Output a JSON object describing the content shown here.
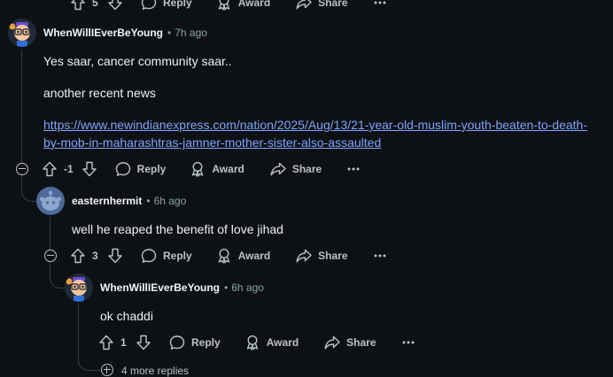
{
  "colors": {
    "background": "#0e1113",
    "text": "#eef1f3",
    "muted": "#8ba2ad",
    "link": "#7ea4ff",
    "thread_line": "#333d42"
  },
  "top_bar": {
    "score": "5",
    "reply": "Reply",
    "award": "Award",
    "share": "Share",
    "more": "···"
  },
  "comment1": {
    "author": "WhenWillIEverBeYoung",
    "separator": "•",
    "time": "7h ago",
    "para1": "Yes saar, cancer community saar..",
    "para2": "another recent news",
    "link": "https://www.newindianexpress.com/nation/2025/Aug/13/21-year-old-muslim-youth-beaten-to-death-by-mob-in-maharashtras-jamner-mother-sister-also-assaulted",
    "link_line1": "https://www.newindianexpress.com/nation/2025/Aug/13/21-year-old-muslim-youth-beaten-to-death-",
    "link_line2": "by-mob-in-maharashtras-jamner-mother-sister-also-assaulted",
    "score": "-1",
    "reply": "Reply",
    "award": "Award",
    "share": "Share",
    "more": "···"
  },
  "comment2": {
    "author": "easternhermit",
    "separator": "•",
    "time": "6h ago",
    "body": "well he reaped the benefit of love jihad",
    "score": "3",
    "reply": "Reply",
    "award": "Award",
    "share": "Share",
    "more": "···"
  },
  "comment3": {
    "author": "WhenWillIEverBeYoung",
    "separator": "•",
    "time": "6h ago",
    "body": "ok chaddi",
    "score": "1",
    "reply": "Reply",
    "award": "Award",
    "share": "Share",
    "more": "···"
  },
  "more_replies": "4 more replies",
  "icons": {
    "upvote": "upvote-icon",
    "downvote": "downvote-icon",
    "reply": "reply-bubble-icon",
    "award": "award-icon",
    "share": "share-icon",
    "more": "more-icon",
    "collapse": "collapse-icon",
    "expand": "expand-icon"
  }
}
